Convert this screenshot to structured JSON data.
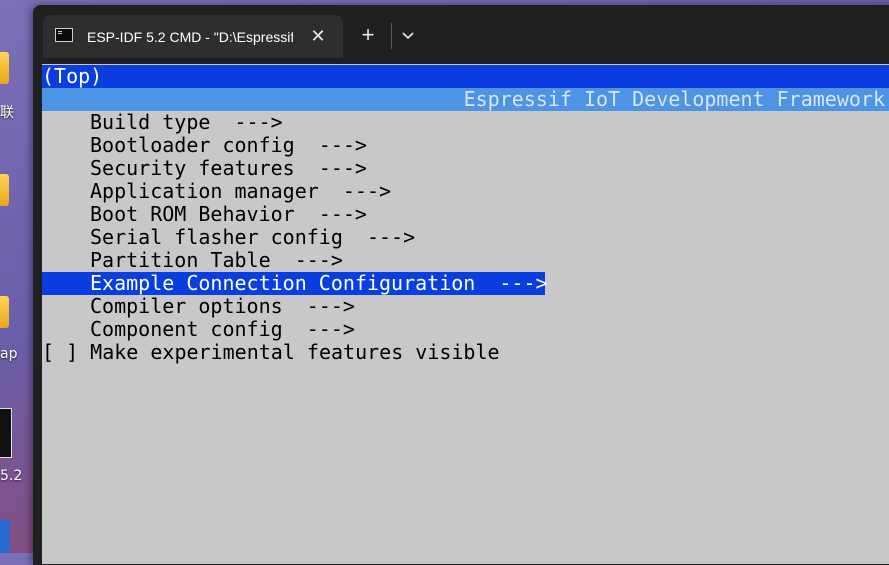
{
  "desktop": {
    "label_1": "联",
    "label_2": "ap",
    "label_3": "5.2"
  },
  "tab": {
    "title": "ESP-IDF 5.2 CMD - \"D:\\Espressif",
    "close_glyph": "✕"
  },
  "toolbar": {
    "new_tab_glyph": "+"
  },
  "terminal": {
    "breadcrumb": "(Top)",
    "header_title": "Espressif IoT Development Framework",
    "menu": [
      {
        "label": "Build type  --->"
      },
      {
        "label": "Bootloader config  --->"
      },
      {
        "label": "Security features  --->"
      },
      {
        "label": "Application manager  --->"
      },
      {
        "label": "Boot ROM Behavior  --->"
      },
      {
        "label": "Serial flasher config  --->"
      },
      {
        "label": "Partition Table  --->"
      },
      {
        "label": "Example Connection Configuration  --->",
        "selected": true
      },
      {
        "label": "Compiler options  --->"
      },
      {
        "label": "Component config  --->"
      }
    ],
    "option": "[ ] Make experimental features visible"
  },
  "colors": {
    "terminal_bg": "#c8c8c8",
    "selection": "#0b3ee0",
    "title_bar": "#4d93e6"
  }
}
